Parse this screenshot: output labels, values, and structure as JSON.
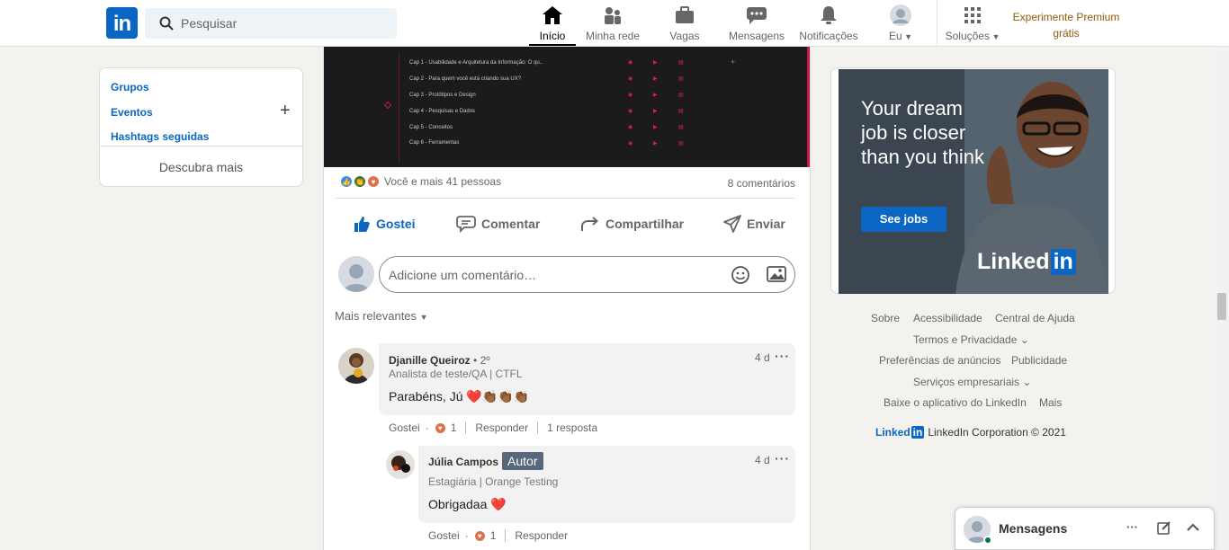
{
  "nav": {
    "search_placeholder": "Pesquisar",
    "items": [
      {
        "label": "Início"
      },
      {
        "label": "Minha rede"
      },
      {
        "label": "Vagas"
      },
      {
        "label": "Mensagens"
      },
      {
        "label": "Notificações"
      },
      {
        "label": "Eu"
      },
      {
        "label": "Soluções"
      }
    ],
    "premium_line1": "Experimente Premium",
    "premium_line2": "grátis"
  },
  "sidebar": {
    "groups": "Grupos",
    "events": "Eventos",
    "hashtags": "Hashtags seguidas",
    "discover": "Descubra mais"
  },
  "post": {
    "chapters": [
      "Cap 1 - Usabilidade e Arquitetura da Informação: O qu..",
      "Cap 2 - Para quem você está criando sua UX?",
      "Cap 3 - Protótipos e Design",
      "Cap 4 - Pesquisas e Dados",
      "Cap 5 - Conceitos",
      "Cap 6 - Ferramentas"
    ],
    "reactions_text": "Você e mais 41 pessoas",
    "comments_count": "8 comentários",
    "actions": {
      "like": "Gostei",
      "comment": "Comentar",
      "share": "Compartilhar",
      "send": "Enviar"
    },
    "comment_placeholder": "Adicione um comentário…",
    "sort_label": "Mais relevantes"
  },
  "comments": [
    {
      "name": "Djanille Queiroz",
      "degree": "• 2º",
      "headline": "Analista de teste/QA | CTFL",
      "text": "Parabéns, Jú ❤️👏🏾👏🏾👏🏾",
      "time": "4 d",
      "like_label": "Gostei",
      "like_count": "1",
      "reply_label": "Responder",
      "replies": "1 resposta"
    },
    {
      "name": "Júlia Campos",
      "badge": "Autor",
      "headline": "Estagiária | Orange Testing",
      "text": "Obrigadaa ❤️",
      "time": "4 d",
      "like_label": "Gostei",
      "like_count": "1",
      "reply_label": "Responder"
    }
  ],
  "ad": {
    "headline": "Your dream job is closer than you think",
    "button": "See jobs",
    "logo_text": "Linked",
    "logo_in": "in"
  },
  "footer": {
    "links": [
      "Sobre",
      "Acessibilidade",
      "Central de Ajuda",
      "Termos e Privacidade",
      "Preferências de anúncios",
      "Publicidade",
      "Serviços empresariais",
      "Baixe o aplicativo do LinkedIn",
      "Mais"
    ],
    "brand": "Linked",
    "brand_in": "in",
    "copyright": "LinkedIn Corporation © 2021"
  },
  "messaging": {
    "title": "Mensagens"
  },
  "colors": {
    "brand_blue": "#0a66c2",
    "premium_gold": "#915907",
    "online_green": "#057642"
  }
}
